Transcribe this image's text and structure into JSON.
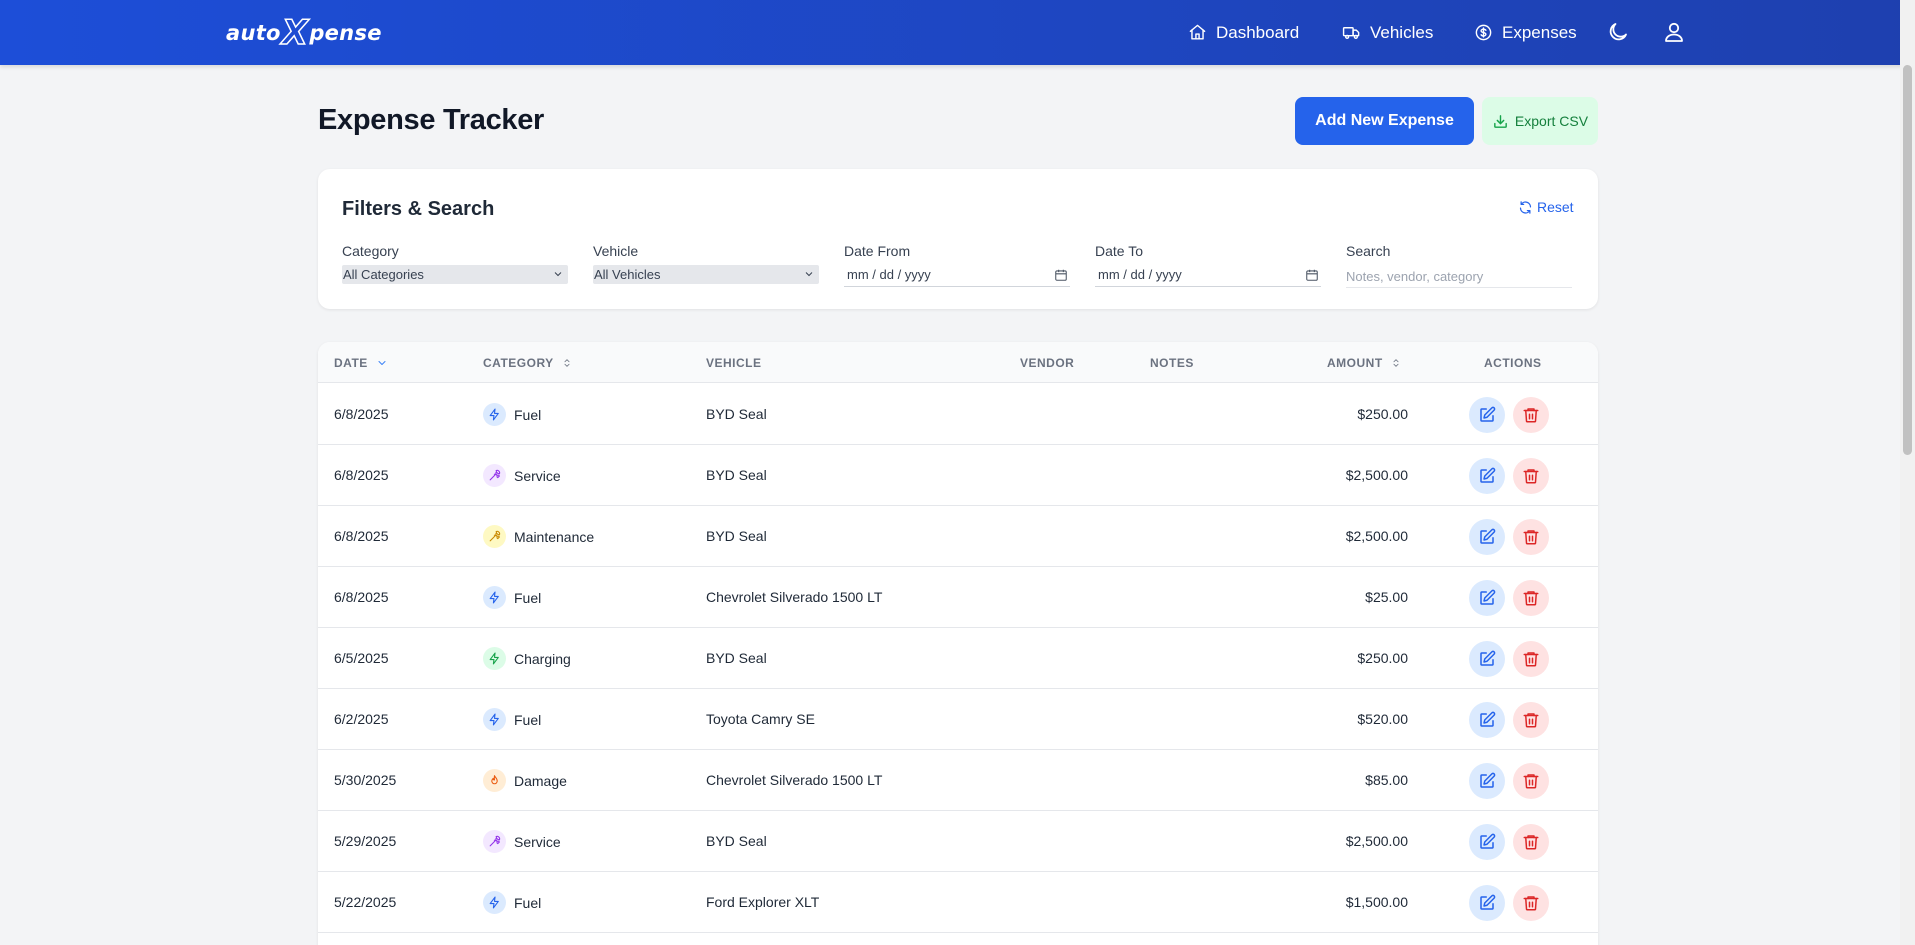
{
  "header": {
    "logo_left": "auto",
    "logo_x": "X",
    "logo_right": "pense",
    "nav": {
      "dashboard": "Dashboard",
      "vehicles": "Vehicles",
      "expenses": "Expenses"
    },
    "icons": {
      "dashboard": "home-icon",
      "vehicles": "truck-icon",
      "expenses": "dollar-circle-icon",
      "theme": "moon-icon",
      "profile": "user-icon"
    },
    "color": "#1d4ed8"
  },
  "page": {
    "title": "Expense Tracker",
    "add_button": "Add New Expense",
    "export_button": "Export CSV"
  },
  "filters": {
    "title": "Filters & Search",
    "reset": "Reset",
    "category_label": "Category",
    "category_value": "All Categories",
    "vehicle_label": "Vehicle",
    "vehicle_value": "All Vehicles",
    "date_from_label": "Date From",
    "date_from_value": "mm / dd / yyyy",
    "date_to_label": "Date To",
    "date_to_value": "mm / dd / yyyy",
    "search_label": "Search",
    "search_placeholder": "Notes, vendor, category"
  },
  "table": {
    "columns": {
      "date": "DATE",
      "category": "CATEGORY",
      "vehicle": "VEHICLE",
      "vendor": "VENDOR",
      "notes": "NOTES",
      "amount": "AMOUNT",
      "actions": "ACTIONS"
    },
    "rows": [
      {
        "date": "6/8/2025",
        "category": "Fuel",
        "vehicle": "BYD Seal",
        "vendor": "",
        "notes": "",
        "amount": "$250.00"
      },
      {
        "date": "6/8/2025",
        "category": "Service",
        "vehicle": "BYD Seal",
        "vendor": "",
        "notes": "",
        "amount": "$2,500.00"
      },
      {
        "date": "6/8/2025",
        "category": "Maintenance",
        "vehicle": "BYD Seal",
        "vendor": "",
        "notes": "",
        "amount": "$2,500.00"
      },
      {
        "date": "6/8/2025",
        "category": "Fuel",
        "vehicle": "Chevrolet Silverado 1500 LT",
        "vendor": "",
        "notes": "",
        "amount": "$25.00"
      },
      {
        "date": "6/5/2025",
        "category": "Charging",
        "vehicle": "BYD Seal",
        "vendor": "",
        "notes": "",
        "amount": "$250.00"
      },
      {
        "date": "6/2/2025",
        "category": "Fuel",
        "vehicle": "Toyota Camry SE",
        "vendor": "",
        "notes": "",
        "amount": "$520.00"
      },
      {
        "date": "5/30/2025",
        "category": "Damage",
        "vehicle": "Chevrolet Silverado 1500 LT",
        "vendor": "",
        "notes": "",
        "amount": "$85.00"
      },
      {
        "date": "5/29/2025",
        "category": "Service",
        "vehicle": "BYD Seal",
        "vendor": "",
        "notes": "",
        "amount": "$2,500.00"
      },
      {
        "date": "5/22/2025",
        "category": "Fuel",
        "vehicle": "Ford Explorer XLT",
        "vendor": "",
        "notes": "",
        "amount": "$1,500.00"
      }
    ]
  },
  "category_styles": {
    "Fuel": {
      "icon": "bolt-icon",
      "bg": "#dbeafe",
      "fg": "#2563eb"
    },
    "Service": {
      "icon": "wrench-icon",
      "bg": "#f3e8ff",
      "fg": "#9333ea"
    },
    "Maintenance": {
      "icon": "wrench-icon",
      "bg": "#fef9c3",
      "fg": "#ca8a04"
    },
    "Charging": {
      "icon": "bolt-icon",
      "bg": "#dcfce7",
      "fg": "#16a34a"
    },
    "Damage": {
      "icon": "flame-icon",
      "bg": "#ffedd5",
      "fg": "#ea580c"
    }
  }
}
